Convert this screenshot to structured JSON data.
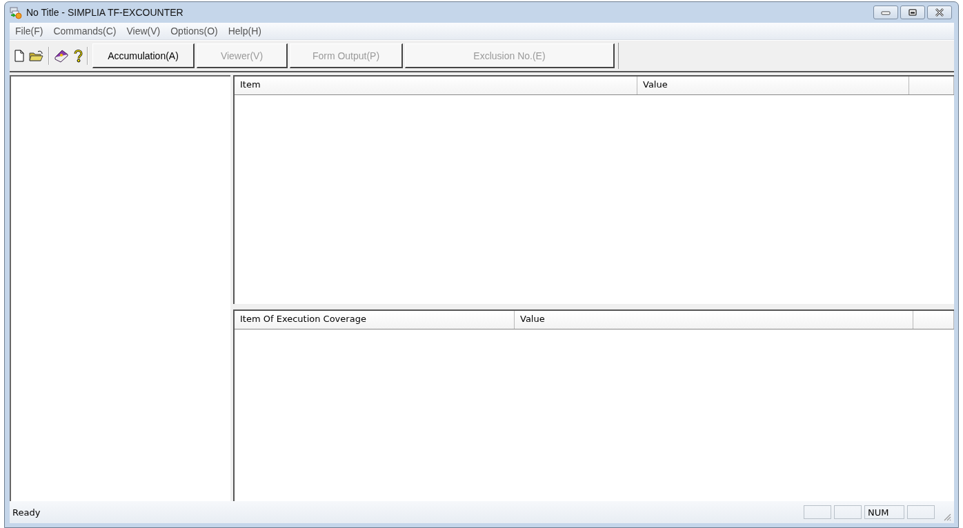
{
  "window": {
    "title": "No Title - SIMPLIA TF-EXCOUNTER"
  },
  "menu": [
    "File(F)",
    "Commands(C)",
    "View(V)",
    "Options(O)",
    "Help(H)"
  ],
  "toolbar": {
    "buttons": [
      {
        "label": "Accumulation(A)",
        "disabled": false
      },
      {
        "label": "Viewer(V)",
        "disabled": true
      },
      {
        "label": "Form Output(P)",
        "disabled": true
      },
      {
        "label": "Exclusion No.(E)",
        "disabled": true
      }
    ]
  },
  "top_list": {
    "columns": [
      "Item",
      "Value"
    ]
  },
  "bottom_list": {
    "columns": [
      "Item Of Execution Coverage",
      "Value"
    ]
  },
  "status_bar": {
    "text": "Ready",
    "indicators": [
      "NUM"
    ]
  }
}
